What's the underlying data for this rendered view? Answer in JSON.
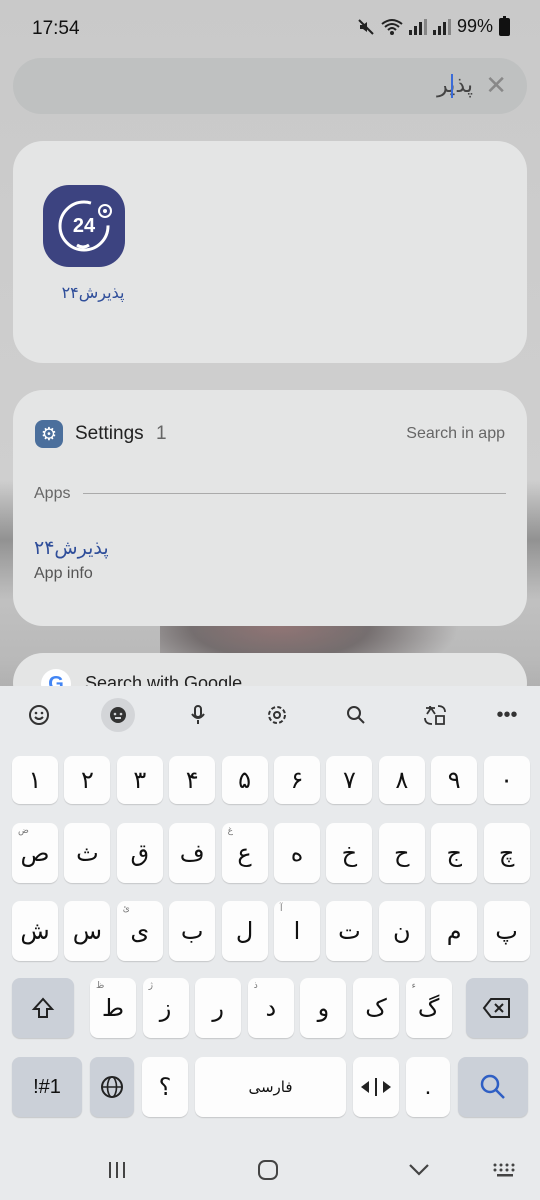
{
  "status": {
    "time": "17:54",
    "battery": "99%"
  },
  "search": {
    "query": "پذیر",
    "clear": "✕"
  },
  "app_result": {
    "icon_text": "24",
    "name": "پذیرش۲۴"
  },
  "settings": {
    "title": "Settings",
    "count": "1",
    "search_in_app": "Search in app",
    "section": "Apps",
    "result_name": "پذیرش۲۴",
    "result_sub": "App info"
  },
  "google": {
    "icon": "G",
    "label": "Search with Google"
  },
  "keyboard": {
    "row_numbers": [
      "۱",
      "۲",
      "۳",
      "۴",
      "۵",
      "۶",
      "۷",
      "۸",
      "۹",
      "۰"
    ],
    "row1": [
      "ص",
      "ث",
      "ق",
      "ف",
      "ع",
      "ه",
      "خ",
      "ح",
      "ج",
      "چ"
    ],
    "row1_hints": [
      "ض",
      "",
      "",
      "",
      "غ",
      "",
      "",
      "",
      "",
      ""
    ],
    "row2": [
      "ش",
      "س",
      "ی",
      "ب",
      "ل",
      "ا",
      "ت",
      "ن",
      "م",
      "پ"
    ],
    "row2_hints": [
      "",
      "",
      "ئ",
      "",
      "",
      "آ",
      "",
      "",
      "",
      ""
    ],
    "row3": [
      "ظ",
      "ط",
      "ز",
      "ر",
      "ذ",
      "د",
      "و",
      "ک",
      "گ"
    ],
    "row3_hints": [
      "ظ",
      "ژ",
      "",
      "",
      "ذ",
      "",
      "",
      "ء",
      ""
    ],
    "row3_letters": [
      "ط",
      "ز",
      "ر",
      "د",
      "و",
      "ک",
      "گ"
    ],
    "row3_letter_hints": [
      "ظ",
      "ژ",
      "",
      "ذ",
      "",
      "",
      "ء"
    ],
    "sym_label": "!#1",
    "question": "؟",
    "space_label": "فارسی",
    "period": ".",
    "toolbar_more": "•••"
  },
  "colors": {
    "accent": "#2f4e9a",
    "keyboard_bg": "#e8eaec",
    "app_icon": "#3c4380"
  }
}
